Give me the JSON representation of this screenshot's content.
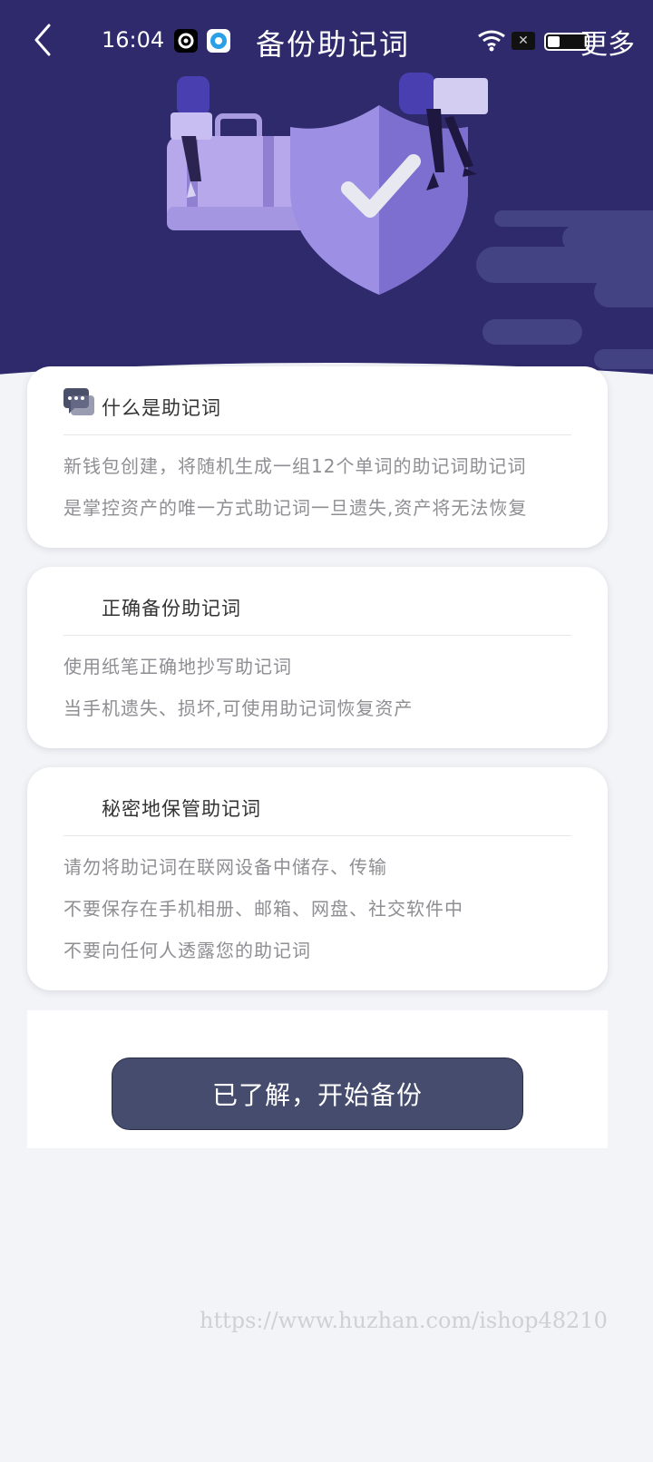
{
  "status_bar": {
    "time": "16:04",
    "battery_level": 0.3,
    "sim_label": "✕"
  },
  "nav": {
    "title": "备份助记词",
    "more_label": "更多"
  },
  "colors": {
    "header_bg": "#2e2a6b",
    "page_bg": "#f3f4f7",
    "button_bg": "#454c6e",
    "shield": "#8c7fd6"
  },
  "cards": [
    {
      "title": "什么是助记词",
      "icon": "chat-bubbles-icon",
      "lines": [
        "新钱包创建，将随机生成一组12个单词的助记词助记词",
        "是掌控资产的唯一方式助记词一旦遗失,资产将无法恢复"
      ]
    },
    {
      "title": "正确备份助记词",
      "lines": [
        "使用纸笔正确地抄写助记词",
        "当手机遗失、损坏,可使用助记词恢复资产"
      ]
    },
    {
      "title": "秘密地保管助记词",
      "lines": [
        "请勿将助记词在联网设备中储存、传输",
        "不要保存在手机相册、邮箱、网盘、社交软件中",
        "不要向任何人透露您的助记词"
      ]
    }
  ],
  "action": {
    "start_label": "已了解，开始备份"
  },
  "watermark": "https://www.huzhan.com/ishop48210"
}
